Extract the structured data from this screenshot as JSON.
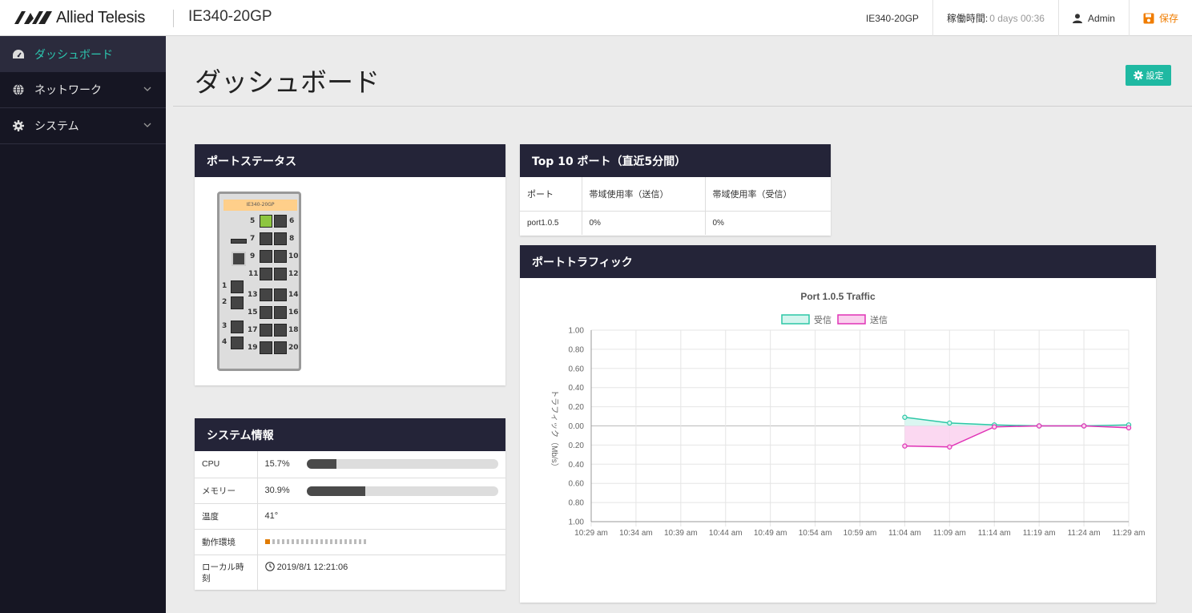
{
  "header": {
    "brand": "Allied Telesis",
    "device": "IE340-20GP",
    "hostname": "IE340-20GP",
    "uptime_label": "稼働時間:",
    "uptime_value": "0 days 00:36",
    "user": "Admin",
    "save": "保存"
  },
  "sidebar": {
    "items": [
      {
        "label": "ダッシュボード",
        "icon": "dashboard-icon"
      },
      {
        "label": "ネットワーク",
        "icon": "globe-icon"
      },
      {
        "label": "システム",
        "icon": "gear-icon"
      }
    ]
  },
  "page": {
    "title": "ダッシュボード",
    "settings_button": "設定"
  },
  "port_status": {
    "title": "ポートステータス",
    "model_label": "IE340-20GP",
    "ports_up": [
      5
    ]
  },
  "top10": {
    "title": "Top 10 ポート（直近5分間）",
    "columns": [
      "ポート",
      "帯域使用率（送信）",
      "帯域使用率（受信）"
    ],
    "rows": [
      [
        "port1.0.5",
        "0%",
        "0%"
      ]
    ]
  },
  "system_info": {
    "title": "システム情報",
    "cpu_label": "CPU",
    "cpu_value": "15.7%",
    "cpu_fraction": 0.157,
    "mem_label": "メモリー",
    "mem_value": "30.9%",
    "mem_fraction": 0.309,
    "temp_label": "温度",
    "temp_value": "41°",
    "env_label": "動作環境",
    "time_label": "ローカル時刻",
    "time_value": "2019/8/1 12:21:06"
  },
  "traffic": {
    "title": "ポートトラフィック"
  },
  "chart_data": {
    "type": "line",
    "title": "Port 1.0.5 Traffic",
    "ylabel": "トラフィック（Mb/s）",
    "xlabel": "",
    "x": [
      "10:29 am",
      "10:34 am",
      "10:39 am",
      "10:44 am",
      "10:49 am",
      "10:54 am",
      "10:59 am",
      "11:04 am",
      "11:09 am",
      "11:14 am",
      "11:19 am",
      "11:24 am",
      "11:29 am"
    ],
    "ylim": [
      -1.0,
      1.0
    ],
    "yticks": [
      "1.00",
      "0.80",
      "0.60",
      "0.40",
      "0.20",
      "0.00",
      "0.20",
      "0.40",
      "0.60",
      "0.80",
      "1.00"
    ],
    "legend_position": "top",
    "series": [
      {
        "name": "受信",
        "color": "#2cc7a6",
        "fill": "#d4f5ee",
        "values": [
          null,
          null,
          null,
          null,
          null,
          null,
          null,
          0.09,
          0.03,
          0.01,
          0.0,
          0.0,
          0.01
        ]
      },
      {
        "name": "送信",
        "color": "#e033b6",
        "fill": "#fad1ee",
        "values": [
          null,
          null,
          null,
          null,
          null,
          null,
          null,
          -0.21,
          -0.22,
          -0.01,
          0.0,
          0.0,
          -0.02
        ]
      }
    ]
  }
}
